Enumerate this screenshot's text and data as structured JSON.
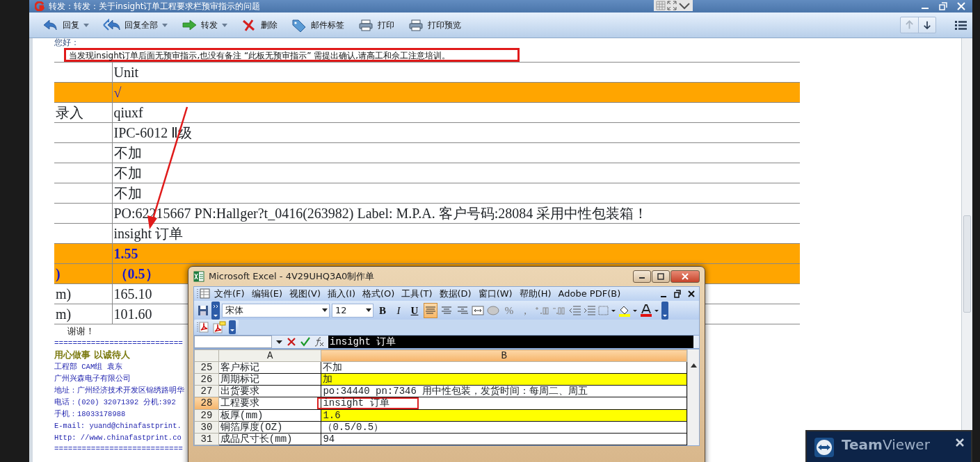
{
  "window": {
    "title": "转发：转发：关于insight订单工程要求栏预审指示的问题"
  },
  "toolbar": [
    {
      "label": "回复",
      "dropdown": true
    },
    {
      "label": "回复全部",
      "dropdown": true
    },
    {
      "label": "转发",
      "dropdown": true
    },
    {
      "label": "删除",
      "dropdown": false
    },
    {
      "label": "邮件标签",
      "dropdown": false
    },
    {
      "label": "打印",
      "dropdown": false
    },
    {
      "label": "打印预览",
      "dropdown": false
    }
  ],
  "nav": [
    {
      "kind": "up",
      "disabled": true
    },
    {
      "kind": "down",
      "disabled": false
    }
  ],
  "email": {
    "greeting": "您好：",
    "notice": {
      "text": "当发现insight订单后面无预审指示,也没有备注 “此板无预审指示” 需提出确认,请高工和佘工注意培训。",
      "annotated": true
    },
    "rows": [
      {
        "label": "",
        "value": "Unit",
        "highlighted": false,
        "emphasis": false
      },
      {
        "label": "",
        "value": "√",
        "highlighted": true,
        "emphasis": true
      },
      {
        "label": "录入",
        "value": "qiuxf",
        "highlighted": false,
        "emphasis": false
      },
      {
        "label": "",
        "value": "IPC-6012 Ⅱ级",
        "highlighted": false,
        "emphasis": false
      },
      {
        "label": "",
        "value": "不加",
        "highlighted": false,
        "emphasis": false
      },
      {
        "label": "",
        "value": "不加",
        "highlighted": false,
        "emphasis": false
      },
      {
        "label": "",
        "value": "不加",
        "highlighted": false,
        "emphasis": false
      },
      {
        "label": "",
        "value": "PO:62215667 PN:Hallger?t_0416(263982) Label: M.P.A. 客户号码:28084 采用中性包装箱！",
        "highlighted": false,
        "emphasis": false
      },
      {
        "label": "",
        "value": "insight 订单",
        "highlighted": false,
        "emphasis": false
      },
      {
        "label": "",
        "value": "1.55",
        "highlighted": true,
        "emphasis": true
      },
      {
        "label": ")",
        "value": "（0.5）",
        "highlighted": true,
        "emphasis": true
      },
      {
        "label": "m)",
        "value": "165.10",
        "highlighted": false,
        "emphasis": false
      },
      {
        "label": "m)",
        "value": "101.60",
        "highlighted": false,
        "emphasis": false
      }
    ],
    "closing": "谢谢！",
    "rule_top": "============================",
    "motto": "用心做事  以诚待人",
    "signature": [
      "工程部  CAM组    袁东",
      "广州兴森电子有限公司",
      "地址：广州经济技术开发区锦绣路明华",
      "电话：(020) 32071392 分机:392",
      "手机：18033178988",
      "E-mail: yuand@chinafastprint.",
      "Http: //www.chinafastprint.co"
    ],
    "rule_bottom": "============================"
  },
  "excel": {
    "title": "Microsoft Excel - 4V29UHQ3A0制作单",
    "menu": [
      "文件(F)",
      "编辑(E)",
      "视图(V)",
      "插入(I)",
      "格式(O)",
      "工具(T)",
      "数据(D)",
      "窗口(W)",
      "帮助(H)",
      "Adobe PDF(B)"
    ],
    "font": "宋体",
    "size": "12",
    "format_buttons": [
      "B",
      "I",
      "U"
    ],
    "alignment": [
      {
        "pressed": true
      },
      {
        "pressed": false
      },
      {
        "pressed": false
      }
    ],
    "number_buttons": [
      "%",
      ","
    ],
    "formula": "insight 订单",
    "columns": [
      {
        "label": "A",
        "selected": false
      },
      {
        "label": "B",
        "selected": true
      }
    ],
    "rows": [
      {
        "number": "25",
        "a": "客户标记",
        "b": "不加",
        "selected": false,
        "highlighted": false,
        "annotated": false
      },
      {
        "number": "26",
        "a": "周期标记",
        "b": "加",
        "selected": false,
        "highlighted": true,
        "annotated": false
      },
      {
        "number": "27",
        "a": "出货要求",
        "b": "po:34440 pn:7346 用中性包装，发货时间：每周二、周五",
        "selected": false,
        "highlighted": false,
        "annotated": false
      },
      {
        "number": "28",
        "a": "工程要求",
        "b": "insight 订单",
        "selected": true,
        "highlighted": false,
        "annotated": true
      },
      {
        "number": "29",
        "a": "板厚(mm)",
        "b": "1.6",
        "selected": false,
        "highlighted": true,
        "annotated": false
      },
      {
        "number": "30",
        "a": "铜箔厚度(OZ)",
        "b": "（0.5/0.5）",
        "selected": false,
        "highlighted": false,
        "annotated": false
      },
      {
        "number": "31",
        "a": "成品尺寸长(mm)",
        "b": "94",
        "selected": false,
        "highlighted": false,
        "annotated": false
      }
    ]
  },
  "teamviewer": {
    "brand": "**Team**Viewer"
  }
}
